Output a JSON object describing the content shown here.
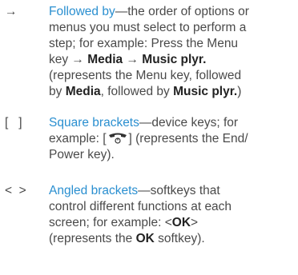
{
  "entries": [
    {
      "symbol": "→",
      "term": "Followed by",
      "line1_rest": "—the order of options or",
      "line2": "menus you must select to perform a",
      "line3": "step; for example: Press the Menu",
      "line4_pre": "key → ",
      "media": "Media",
      "arrow": " → ",
      "music": "Music plyr.",
      "line5": "(represents the Menu key, followed",
      "line6_pre": "by ",
      "line6_media": "Media",
      "line6_mid": ", followed by ",
      "line6_music": "Music plyr.",
      "line6_end": ")"
    },
    {
      "symbol": "[   ]",
      "term": "Square brackets",
      "line1_rest": "—device keys; for",
      "line2_pre": "example: [",
      "icon": "end-power-key-icon",
      "line2_post": "] (represents the End/",
      "line3": "Power key)."
    },
    {
      "symbol": "<  >",
      "term": "Angled brackets",
      "line1_rest": "—softkeys that",
      "line2": "control different functions at each",
      "line3_pre": "screen; for example: <",
      "ok": "OK",
      "line3_post": ">",
      "line4_pre": "(represents the ",
      "line4_ok": "OK",
      "line4_post": " softkey)."
    }
  ],
  "colors": {
    "term": "#2a8fd0",
    "body": "#4a4a4a"
  }
}
